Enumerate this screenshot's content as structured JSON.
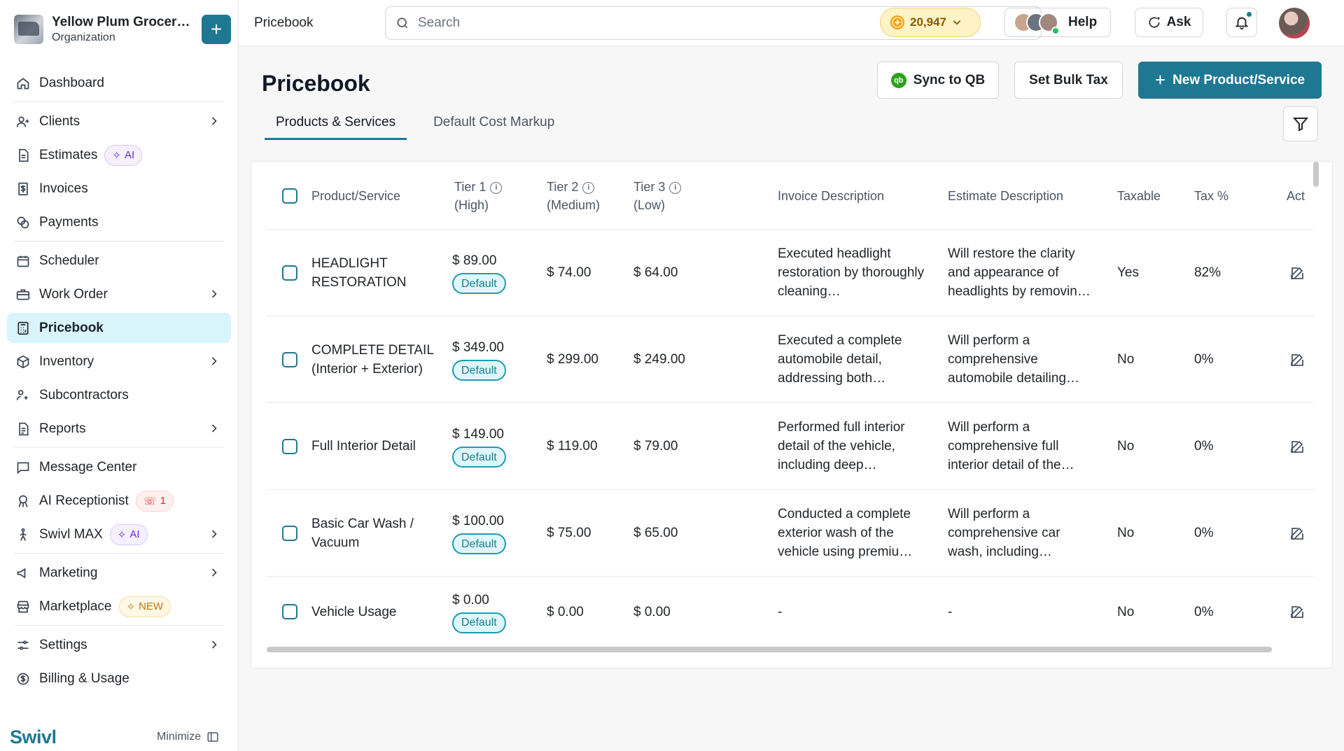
{
  "org": {
    "name": "Yellow Plum Grocers...",
    "subtitle": "Organization"
  },
  "sidebar": {
    "items": [
      {
        "key": "dashboard",
        "label": "Dashboard",
        "icon": "home-icon"
      },
      {
        "key": "clients",
        "label": "Clients",
        "icon": "user-plus-icon",
        "chevron": true
      },
      {
        "key": "estimates",
        "label": "Estimates",
        "icon": "document-icon",
        "badge": "AI"
      },
      {
        "key": "invoices",
        "label": "Invoices",
        "icon": "dollar-doc-icon"
      },
      {
        "key": "payments",
        "label": "Payments",
        "icon": "coins-icon"
      },
      {
        "key": "scheduler",
        "label": "Scheduler",
        "icon": "calendar-icon"
      },
      {
        "key": "work-order",
        "label": "Work Order",
        "icon": "toolbox-icon",
        "chevron": true
      },
      {
        "key": "pricebook",
        "label": "Pricebook",
        "icon": "calculator-icon",
        "active": true
      },
      {
        "key": "inventory",
        "label": "Inventory",
        "icon": "box-icon",
        "chevron": true
      },
      {
        "key": "subcontractors",
        "label": "Subcontractors",
        "icon": "users-icon"
      },
      {
        "key": "reports",
        "label": "Reports",
        "icon": "report-icon",
        "chevron": true
      },
      {
        "key": "message-center",
        "label": "Message Center",
        "icon": "message-icon"
      },
      {
        "key": "ai-receptionist",
        "label": "AI Receptionist",
        "icon": "receptionist-icon",
        "badge": "1"
      },
      {
        "key": "swivl-max",
        "label": "Swivl MAX",
        "icon": "person-walk-icon",
        "badge": "AI",
        "chevron": true
      },
      {
        "key": "marketing",
        "label": "Marketing",
        "icon": "megaphone-icon",
        "chevron": true
      },
      {
        "key": "marketplace",
        "label": "Marketplace",
        "icon": "store-icon",
        "badge": "NEW"
      },
      {
        "key": "settings",
        "label": "Settings",
        "icon": "sliders-icon",
        "chevron": true
      },
      {
        "key": "billing",
        "label": "Billing & Usage",
        "icon": "dollar-circle-icon"
      }
    ],
    "brand": "Swivl",
    "minimize_label": "Minimize"
  },
  "topbar": {
    "breadcrumb": "Pricebook",
    "search_placeholder": "Search",
    "points": "20,947",
    "help_label": "Help",
    "ask_label": "Ask"
  },
  "page": {
    "title": "Pricebook",
    "sync_label": "Sync to QB",
    "bulk_tax_label": "Set Bulk Tax",
    "new_label": "New Product/Service",
    "tabs": [
      "Products & Services",
      "Default Cost Markup"
    ]
  },
  "table": {
    "headers": {
      "product": "Product/Service",
      "tier1": "Tier 1",
      "tier1_sub": "(High)",
      "tier2": "Tier 2",
      "tier2_sub": "(Medium)",
      "tier3": "Tier 3",
      "tier3_sub": "(Low)",
      "invoice": "Invoice Description",
      "estimate": "Estimate Description",
      "taxable": "Taxable",
      "tax": "Tax %",
      "action": "Act"
    },
    "default_label": "Default",
    "rows": [
      {
        "product": "HEADLIGHT RESTORATION",
        "tier1": "$ 89.00",
        "tier2": "$ 74.00",
        "tier3": "$ 64.00",
        "invoice": "Executed headlight restoration by thoroughly cleaning…",
        "estimate": "Will restore the clarity and appearance of headlights by removin…",
        "taxable": "Yes",
        "tax": "82%"
      },
      {
        "product": "COMPLETE DETAIL (Interior + Exterior)",
        "tier1": "$ 349.00",
        "tier2": "$ 299.00",
        "tier3": "$ 249.00",
        "invoice": "Executed a complete automobile detail, addressing both…",
        "estimate": "Will perform a comprehensive automobile detailing…",
        "taxable": "No",
        "tax": "0%"
      },
      {
        "product": "Full Interior Detail",
        "tier1": "$ 149.00",
        "tier2": "$ 119.00",
        "tier3": "$ 79.00",
        "invoice": "Performed full interior detail of the vehicle, including deep…",
        "estimate": "Will perform a comprehensive full interior detail of the…",
        "taxable": "No",
        "tax": "0%"
      },
      {
        "product": "Basic Car Wash / Vacuum",
        "tier1": "$ 100.00",
        "tier2": "$ 75.00",
        "tier3": "$ 65.00",
        "invoice": "Conducted a complete exterior wash of the vehicle using premiu…",
        "estimate": "Will perform a comprehensive car wash, including…",
        "taxable": "No",
        "tax": "0%"
      },
      {
        "product": "Vehicle Usage",
        "tier1": "$ 0.00",
        "tier2": "$ 0.00",
        "tier3": "$ 0.00",
        "invoice": "-",
        "estimate": "-",
        "taxable": "No",
        "tax": "0%"
      }
    ]
  },
  "colors": {
    "accent": "#1f7892",
    "active_bg": "#d9f5fb",
    "points_bg": "#fdf3c7"
  }
}
